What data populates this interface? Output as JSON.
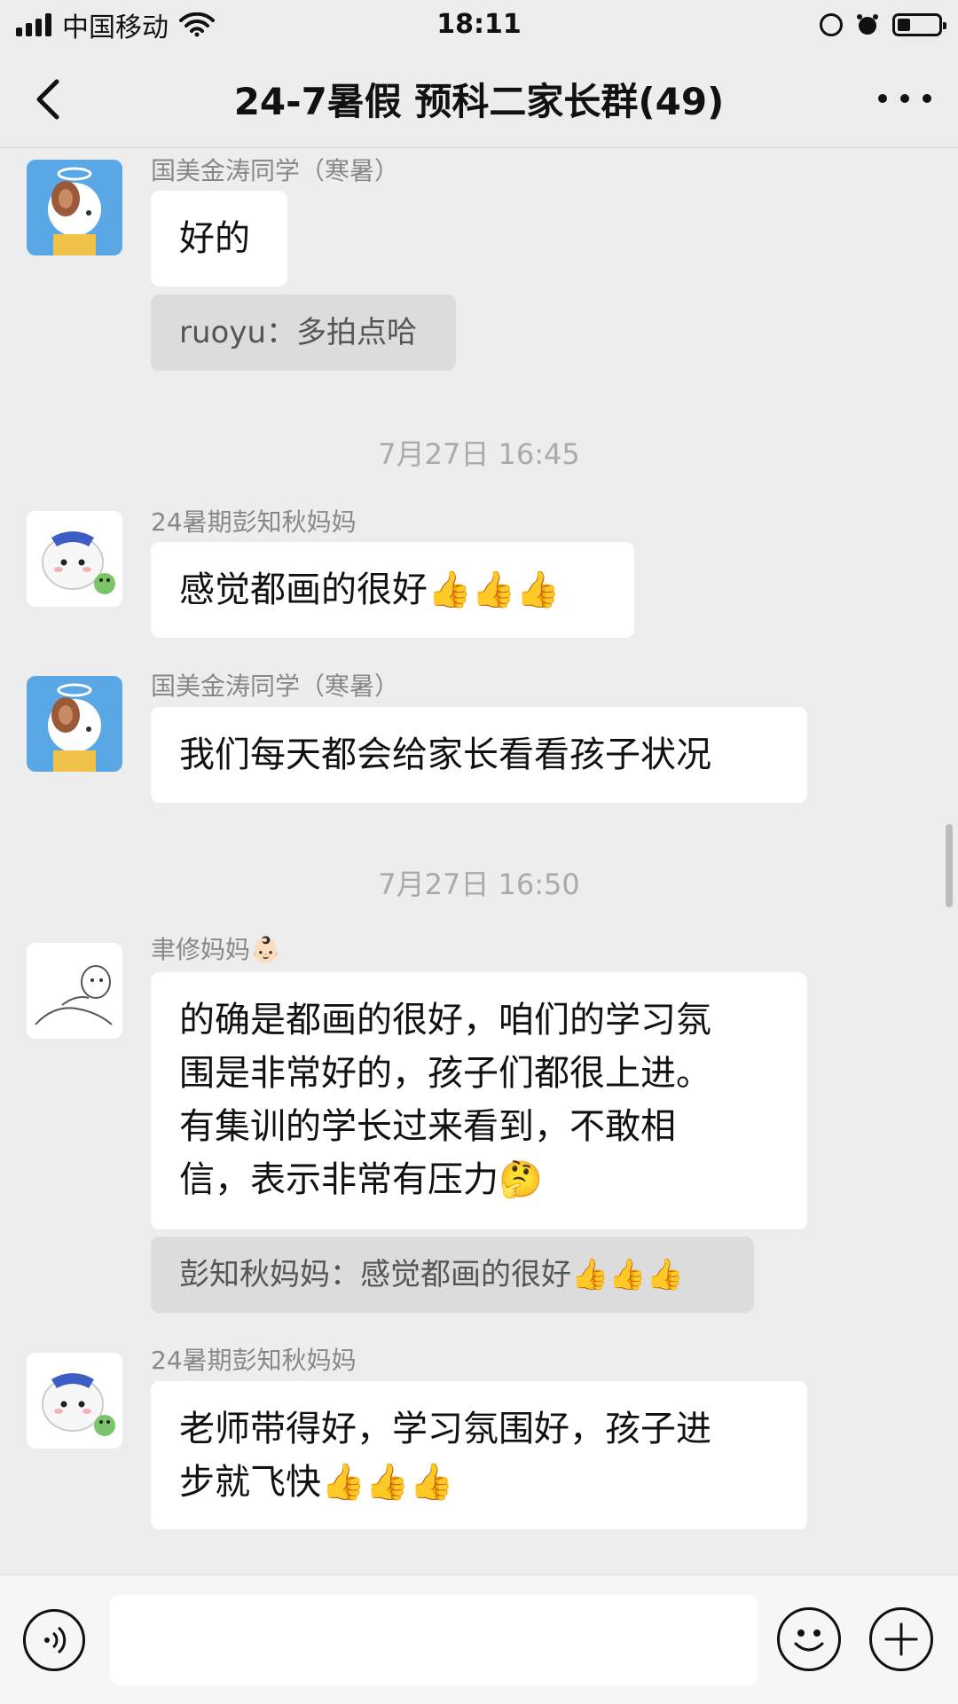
{
  "status_bar": {
    "carrier": "中国移动",
    "time": "18:11"
  },
  "nav": {
    "title": "24-7暑假 预科二家长群(49)"
  },
  "messages": [
    {
      "sender": "国美金涛同学（寒暑）",
      "text": "好的",
      "quote": "ruoyu：多拍点哈"
    },
    {
      "timestamp": "7月27日 16:45"
    },
    {
      "sender": "24暑期彭知秋妈妈",
      "text": "感觉都画的很好👍👍👍"
    },
    {
      "sender": "国美金涛同学（寒暑）",
      "text": "我们每天都会给家长看看孩子状况"
    },
    {
      "timestamp": "7月27日 16:50"
    },
    {
      "sender": "聿修妈妈👶🏻",
      "text_lines": [
        "的确是都画的很好，咱们的学习氛",
        "围是非常好的，孩子们都很上进。",
        "有集训的学长过来看到，不敢相",
        "信，表示非常有压力🤔"
      ],
      "quote": "彭知秋妈妈：感觉都画的很好👍👍👍"
    },
    {
      "sender": "24暑期彭知秋妈妈",
      "text_lines": [
        "老师带得好，学习氛围好，孩子进",
        "步就飞快👍👍👍"
      ]
    }
  ],
  "input": {
    "placeholder": ""
  },
  "icons": {
    "back": "back-chevron-icon",
    "more": "more-dots-icon",
    "voice": "voice-icon",
    "emoji": "emoji-icon",
    "plus": "plus-icon",
    "signal": "signal-icon",
    "wifi": "wifi-icon",
    "lock_rotation": "orientation-lock-icon",
    "alarm": "alarm-icon",
    "battery": "battery-icon"
  },
  "colors": {
    "background": "#ededed",
    "bubble": "#ffffff",
    "quote_bg": "#dcdcdc",
    "sender_text": "#888888",
    "timestamp_text": "#aaaaaa"
  }
}
